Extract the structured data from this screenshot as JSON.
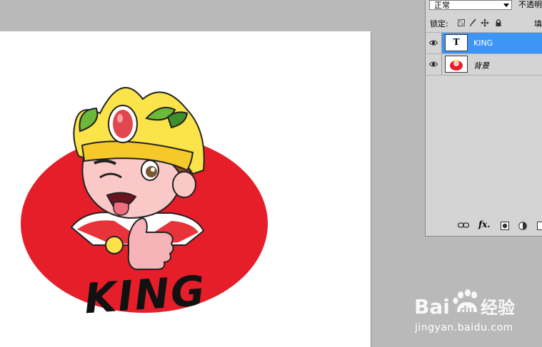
{
  "layers_panel": {
    "blend_mode": "正常",
    "opacity_label": "不透明",
    "lock_label": "锁定:",
    "fill_label": "填",
    "layers": [
      {
        "name": "KING",
        "type": "text",
        "selected": true,
        "visible": true
      },
      {
        "name": "背景",
        "type": "image",
        "selected": false,
        "visible": true
      }
    ],
    "footer": {
      "fx_label": "fx."
    }
  },
  "canvas": {
    "artwork_title": "KING"
  },
  "watermark": {
    "logo_text": "Bai du 经验",
    "url": "jingyan.baidu.com"
  },
  "colors": {
    "workspace": "#b9b9b9",
    "panel": "#d4d4d4",
    "selection": "#3d95f7",
    "oval_red": "#e61e2a"
  },
  "icons": [
    "eye-icon",
    "link-icon",
    "mask-icon",
    "adjustment-icon",
    "new-group-icon",
    "lock-icon",
    "move-icon",
    "brush-icon"
  ]
}
